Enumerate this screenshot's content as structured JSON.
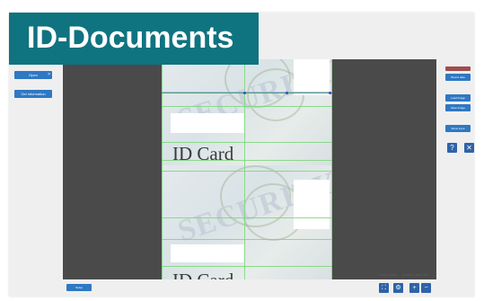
{
  "app": {
    "title": "ID-Documents"
  },
  "left_panel": {
    "open_label": "Open",
    "open_arrow": ">",
    "info_label": "Get information"
  },
  "document": {
    "card_title": "ID Card",
    "watermark": "SECURITY"
  },
  "right_panel": {
    "top_label": "",
    "button1": "Bound data",
    "button2": "Load Image",
    "button3": "Save Image",
    "button4": "Show Input",
    "help_icon_glyph": "?",
    "close_icon_glyph": "✕"
  },
  "status": {
    "left_button": "Setup",
    "coord_a": "X: 404 Y: 1023",
    "coord_b": "W: 657 H: 403 R: 0.0"
  },
  "toolbar": {
    "fit_glyph": "⛶",
    "settings_glyph": "⚙",
    "zoom_in_glyph": "+",
    "zoom_out_glyph": "−"
  },
  "colors": {
    "title_bg": "#0f7380",
    "canvas_bg": "#4a4a4a",
    "button_blue": "#2f78c3",
    "overlay_green": "#7bd67b"
  }
}
